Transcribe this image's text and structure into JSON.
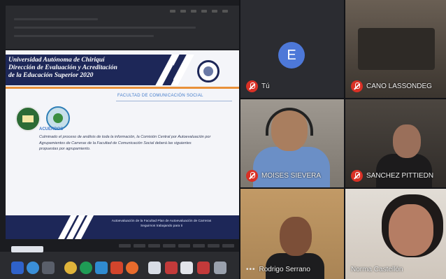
{
  "presentation": {
    "slide_title_lines": [
      "Universidad Autónoma de Chiriquí",
      "Dirección de Evaluación y Acreditación",
      "de la Educación Superior 2020"
    ],
    "faculty_label": "FACULTAD DE COMUNICACIÓN SOCIAL",
    "agreements_heading": "ACUERDOS",
    "agreements_text": "Culminado el proceso de análisis de toda la información, la Comisión Central por Autoevaluación por Agrupamientos de Carreras de la Facultad de Comunicación Social deberá las siguientes propuestas por agrupamiento.",
    "footer_left": "",
    "footer_right_line1": "Autoevaluación de la Facultad Plan de Autoevaluación de Carreras",
    "footer_right_line2": "Seguimos trabajando para ti",
    "colors": {
      "navy": "#1d2758",
      "accent": "#e9913a",
      "blue_text": "#3f79c9"
    }
  },
  "participants": [
    {
      "name": "Tú",
      "avatar_letter": "E",
      "muted": true
    },
    {
      "name": "CANO LASSONDEG",
      "muted": true
    },
    {
      "name": "MOISES SIEVERA",
      "muted": true
    },
    {
      "name": "SANCHEZ PITTIEDN",
      "muted": true
    },
    {
      "name": "Rodrigo Serrano",
      "muted": false
    },
    {
      "name": "Norma Castellón",
      "muted": false
    }
  ],
  "icons": [
    "mic-off-icon",
    "more-icon"
  ]
}
